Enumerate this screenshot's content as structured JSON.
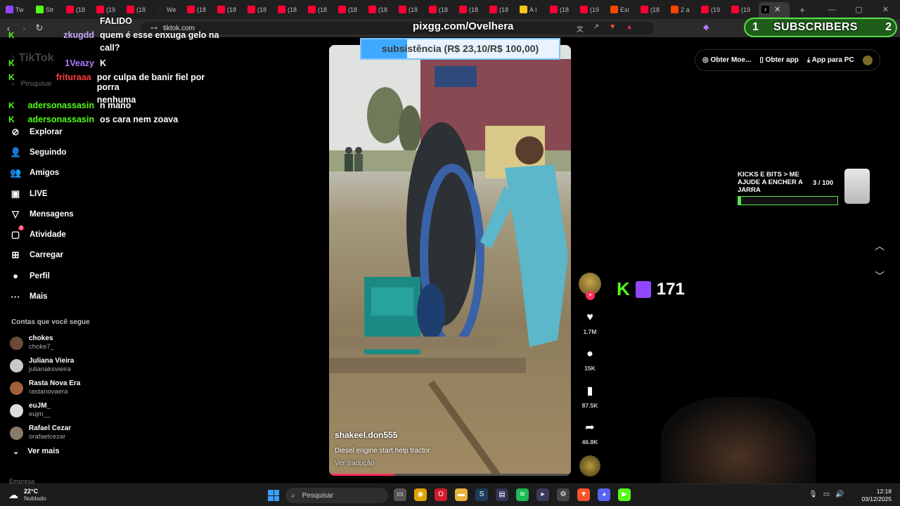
{
  "browser": {
    "tabs": [
      {
        "label": "Tw",
        "color": "#9146ff"
      },
      {
        "label": "Str",
        "color": "#53fc18"
      },
      {
        "label": "(18",
        "color": "#ff0033"
      },
      {
        "label": "(19",
        "color": "#ff0033"
      },
      {
        "label": "(18",
        "color": "#ff0033"
      },
      {
        "label": "We",
        "color": "#222222"
      },
      {
        "label": "(18",
        "color": "#ff0033"
      },
      {
        "label": "(18",
        "color": "#ff0033"
      },
      {
        "label": "(18",
        "color": "#ff0033"
      },
      {
        "label": "(18",
        "color": "#ff0033"
      },
      {
        "label": "(18",
        "color": "#ff0033"
      },
      {
        "label": "(18",
        "color": "#ff0033"
      },
      {
        "label": "(18",
        "color": "#ff0033"
      },
      {
        "label": "(18",
        "color": "#ff0033"
      },
      {
        "label": "(18",
        "color": "#ff0033"
      },
      {
        "label": "(18",
        "color": "#ff0033"
      },
      {
        "label": "(18",
        "color": "#ff0033"
      },
      {
        "label": "A I",
        "color": "#f5c518"
      },
      {
        "label": "(18",
        "color": "#ff0033"
      },
      {
        "label": "(19",
        "color": "#ff0033"
      },
      {
        "label": "Exi",
        "color": "#ff4500"
      },
      {
        "label": "(18",
        "color": "#ff0033"
      },
      {
        "label": "2 a",
        "color": "#ff4500"
      },
      {
        "label": "(19",
        "color": "#ff0033"
      },
      {
        "label": "(19",
        "color": "#ff0033"
      }
    ],
    "active_tab_icon": "tiktok-icon",
    "url": "tiktok.com"
  },
  "overlays": {
    "pix_url": "pixgg.com/Ovelhera",
    "subs_left": "1",
    "subs_label": "SUBSCRIBERS",
    "subs_right": "2",
    "goal_text": "subsistência (R$ 23,10/R$ 100,00)",
    "goal_fraction": 0.231,
    "jar_title": "KICKS E BITS > ME AJUDE A ENCHER A JARRA",
    "jar_count": "3  / 100",
    "jar_fraction": 0.03,
    "kick_count": "171"
  },
  "chat": [
    {
      "user": "",
      "message": "FALIDO",
      "user_color": "#ffffff"
    },
    {
      "user": "zkugdd",
      "message": "quem é esse enxuga gelo na",
      "message2": "call?",
      "user_color": "#c9a6ff"
    },
    {
      "user": "1Veazy",
      "message": "K",
      "user_color": "#b07cff"
    },
    {
      "user": "friturааа",
      "message": "por culpa de banir fiel por porra",
      "message2": "nenhuma",
      "user_color": "#ff3b3b"
    },
    {
      "user": "adersonassasin",
      "message": "n mano",
      "user_color": "#53fc18"
    },
    {
      "user": "adersonassasin",
      "message": "os cara nem zoava",
      "user_color": "#53fc18"
    }
  ],
  "tiktok": {
    "logo": "TikTok",
    "search_placeholder": "Pesquisar",
    "nav": [
      {
        "label": "Explorar",
        "icon": "compass-icon",
        "glyph": "⊘"
      },
      {
        "label": "Seguindo",
        "icon": "user-icon",
        "glyph": "👤"
      },
      {
        "label": "Amigos",
        "icon": "friends-icon",
        "glyph": "👥"
      },
      {
        "label": "LIVE",
        "icon": "live-icon",
        "glyph": "▣"
      },
      {
        "label": "Mensagens",
        "icon": "inbox-icon",
        "glyph": "▽"
      },
      {
        "label": "Atividade",
        "icon": "activity-icon",
        "glyph": "▢",
        "badge": "3"
      },
      {
        "label": "Carregar",
        "icon": "upload-icon",
        "glyph": "⊞"
      },
      {
        "label": "Perfil",
        "icon": "profile-icon",
        "glyph": "●"
      },
      {
        "label": "Mais",
        "icon": "more-icon",
        "glyph": "···"
      }
    ],
    "following_title": "Contas que você segue",
    "following": [
      {
        "name": "chokes",
        "username": "choke7_",
        "color": "#6b4a3a"
      },
      {
        "name": "Juliana Vieira",
        "username": "julianaksvieira",
        "color": "#c9c9c9"
      },
      {
        "name": "Rasta Nova Era",
        "username": "rastanovaera",
        "color": "#a0603a"
      },
      {
        "name": "euJM_",
        "username": "eujm__",
        "color": "#dddddd"
      },
      {
        "name": "Rafael Cezar",
        "username": "orafaelcezar",
        "color": "#8a7a6a"
      }
    ],
    "see_more": "Ver mais",
    "footer": "Empresa",
    "top_actions": [
      "Obter Moe...",
      "Obter app",
      "App para PC"
    ],
    "video": {
      "username": "shakeel.don555",
      "description": "Diesel engine start help tractor",
      "translate": "Ver tradução",
      "progress": 0.27
    },
    "stats": {
      "likes": "1.7M",
      "comments": "15K",
      "saves": "87.5K",
      "shares": "46.8K"
    }
  },
  "taskbar": {
    "temp": "22°C",
    "weather": "Nublado",
    "search": "Pesquisar",
    "time": "12:18",
    "date": "03/12/2025",
    "apps": [
      {
        "name": "task-view-icon",
        "color": "#555555",
        "glyph": "▭"
      },
      {
        "name": "chrome-icon",
        "color": "#e0a200",
        "glyph": "◉"
      },
      {
        "name": "opera-icon",
        "color": "#d01b2a",
        "glyph": "O"
      },
      {
        "name": "folder-icon",
        "color": "#e8b23a",
        "glyph": "▬"
      },
      {
        "name": "steam-icon",
        "color": "#1b3c5a",
        "glyph": "S"
      },
      {
        "name": "app-icon",
        "color": "#333355",
        "glyph": "▤"
      },
      {
        "name": "spotify-icon",
        "color": "#1db954",
        "glyph": "≋"
      },
      {
        "name": "app2-icon",
        "color": "#3a3a5a",
        "glyph": "▸"
      },
      {
        "name": "app3-icon",
        "color": "#444444",
        "glyph": "⚙"
      },
      {
        "name": "brave-icon",
        "color": "#fb542b",
        "glyph": "▼"
      },
      {
        "name": "discord-icon",
        "color": "#5865f2",
        "glyph": "◕"
      },
      {
        "name": "kick-app-icon",
        "color": "#53fc18",
        "glyph": "▶"
      }
    ]
  }
}
